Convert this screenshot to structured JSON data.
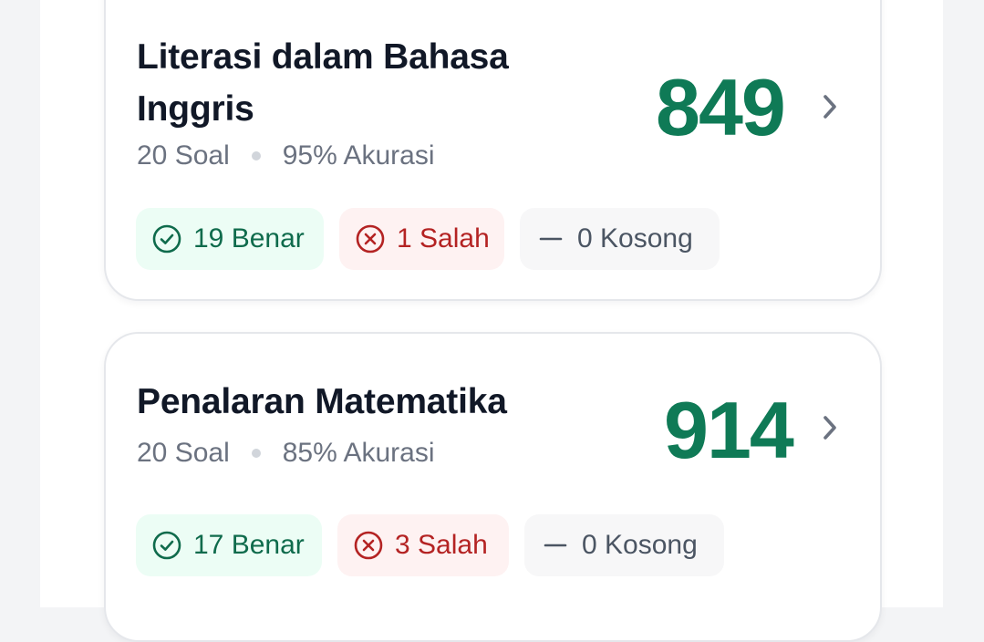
{
  "colors": {
    "score": "#0f7a56",
    "correct_bg": "#ecfdf5",
    "correct_text": "#0f6b4c",
    "wrong_bg": "#fef2f2",
    "wrong_text": "#b42323",
    "empty_bg": "#f7f7f8",
    "empty_text": "#4b5563"
  },
  "cards": [
    {
      "title": "Literasi dalam Bahasa Inggris",
      "questions": "20 Soal",
      "accuracy": "95% Akurasi",
      "score": "849",
      "correct": "19 Benar",
      "wrong": "1 Salah",
      "empty": "0 Kosong",
      "icons": {
        "correct": "check-circle-icon",
        "wrong": "x-circle-icon",
        "empty": "dash-icon",
        "open": "chevron-right-icon"
      }
    },
    {
      "title": "Penalaran Matematika",
      "questions": "20 Soal",
      "accuracy": "85% Akurasi",
      "score": "914",
      "correct": "17 Benar",
      "wrong": "3 Salah",
      "empty": "0 Kosong",
      "icons": {
        "correct": "check-circle-icon",
        "wrong": "x-circle-icon",
        "empty": "dash-icon",
        "open": "chevron-right-icon"
      }
    }
  ]
}
